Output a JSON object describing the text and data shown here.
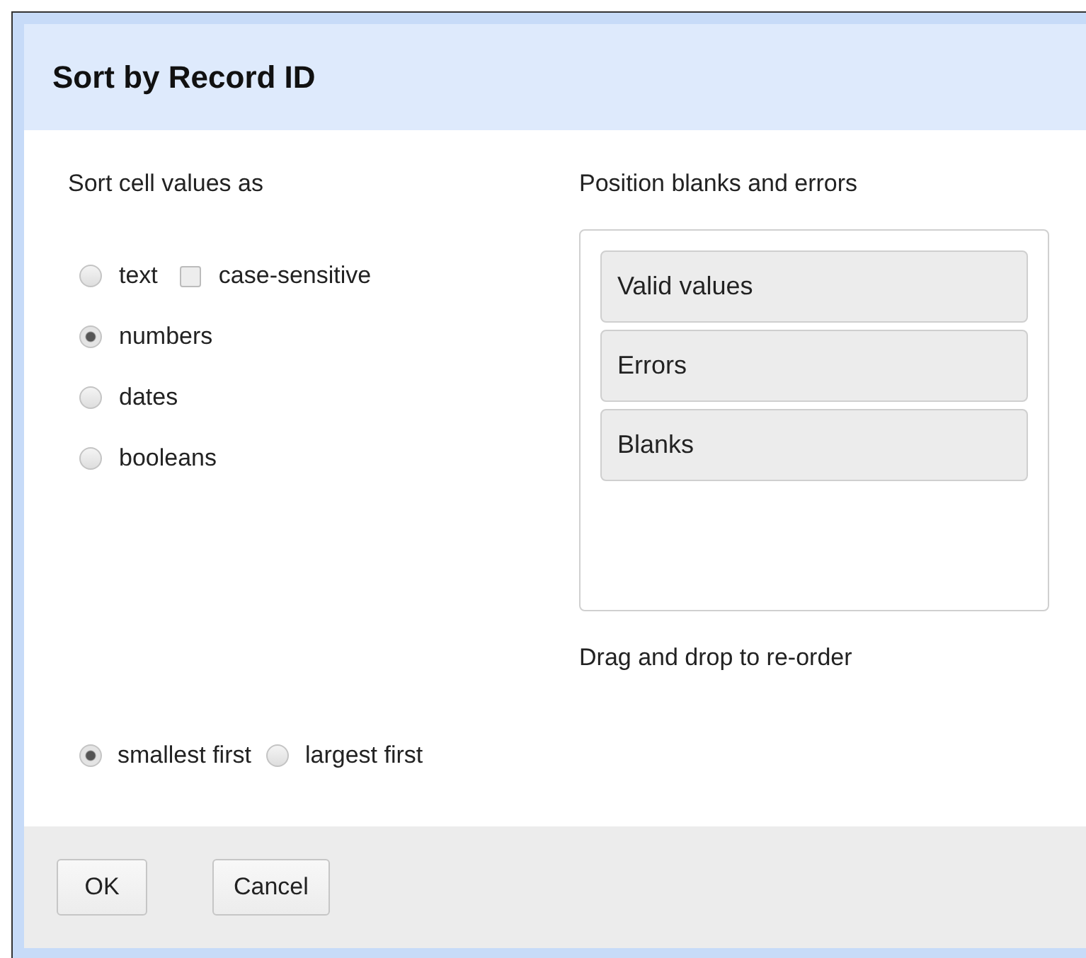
{
  "dialog": {
    "title": "Sort by Record ID"
  },
  "sort_as": {
    "label": "Sort cell values as",
    "options": [
      {
        "label": "text",
        "selected": false,
        "case_sensitive": {
          "label": "case-sensitive",
          "checked": false
        }
      },
      {
        "label": "numbers",
        "selected": true
      },
      {
        "label": "dates",
        "selected": false
      },
      {
        "label": "booleans",
        "selected": false
      }
    ]
  },
  "positions": {
    "label": "Position blanks and errors",
    "items": [
      "Valid values",
      "Errors",
      "Blanks"
    ],
    "hint": "Drag and drop to re-order"
  },
  "order": [
    {
      "label": "smallest first",
      "selected": true
    },
    {
      "label": "largest first",
      "selected": false
    }
  ],
  "buttons": [
    "OK",
    "Cancel"
  ]
}
